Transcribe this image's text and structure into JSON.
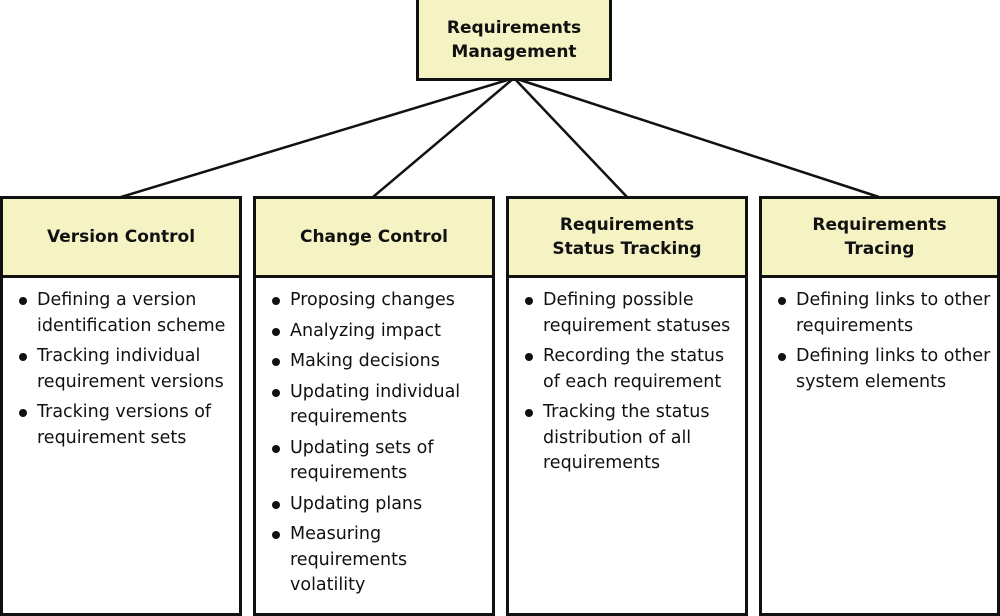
{
  "root": {
    "title_lines": [
      "Requirements",
      "Management"
    ]
  },
  "columns": [
    {
      "title_lines": [
        "Version Control"
      ],
      "items": [
        "Defining a version identification scheme",
        "Tracking individual requirement versions",
        "Tracking versions of requirement sets"
      ]
    },
    {
      "title_lines": [
        "Change Control"
      ],
      "items": [
        "Proposing changes",
        "Analyzing impact",
        "Making decisions",
        "Updating individual requirements",
        "Updating sets of requirements",
        "Updating plans",
        "Measuring requirements volatility"
      ]
    },
    {
      "title_lines": [
        "Requirements",
        "Status Tracking"
      ],
      "items": [
        "Defining possible requirement statuses",
        "Recording the status of each requirement",
        "Tracking the status distribution of all requirements"
      ]
    },
    {
      "title_lines": [
        "Requirements",
        "Tracing"
      ],
      "items": [
        "Defining links to other requirements",
        "Defining links to other system elements"
      ]
    }
  ],
  "colors": {
    "header_fill": "#f5f3c4",
    "border": "#111111"
  }
}
